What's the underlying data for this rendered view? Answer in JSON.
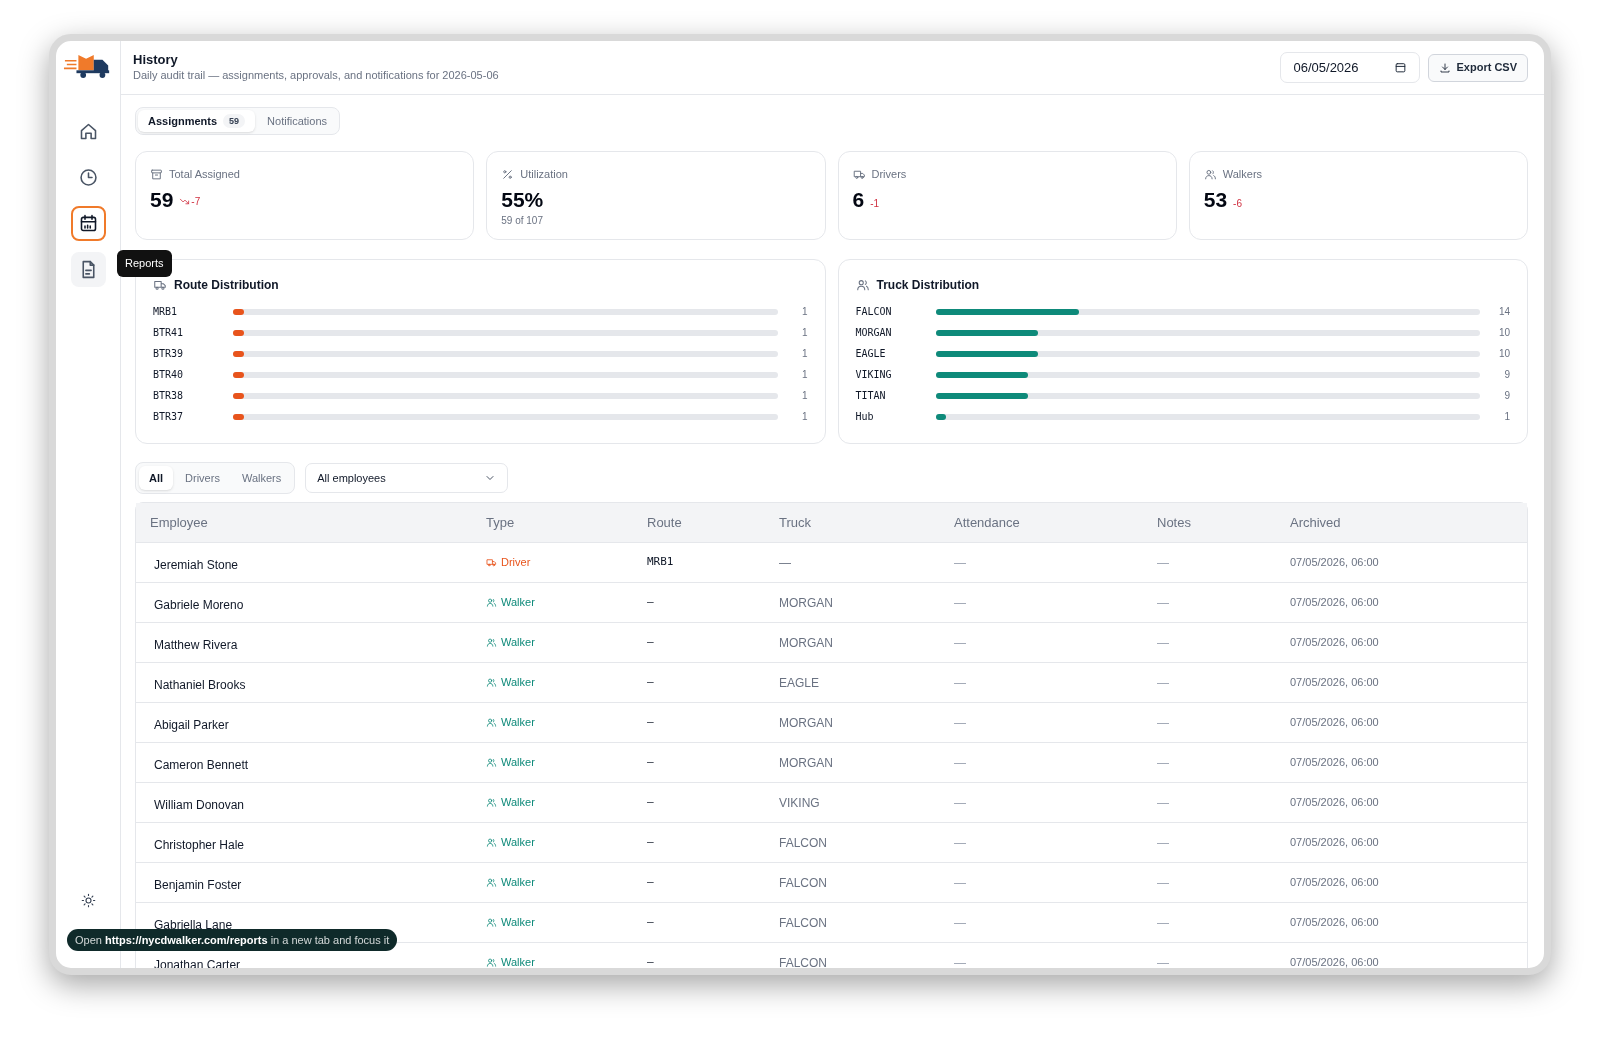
{
  "header": {
    "title": "History",
    "subtitle": "Daily audit trail — assignments, approvals, and notifications for 2026-05-06",
    "date": "06/05/2026",
    "export_label": "Export CSV"
  },
  "sidebar": {
    "items": [
      {
        "kind": "home",
        "selected": false,
        "hovered": false
      },
      {
        "kind": "history",
        "selected": false,
        "hovered": false
      },
      {
        "kind": "calendar",
        "selected": true,
        "hovered": false
      },
      {
        "kind": "reports",
        "selected": false,
        "hovered": true
      }
    ],
    "tooltip": "Reports"
  },
  "tabs": [
    {
      "label": "Assignments",
      "count": "59",
      "selected": true
    },
    {
      "label": "Notifications",
      "selected": false
    }
  ],
  "stats": [
    {
      "kind": "archive",
      "label": "Total Assigned",
      "value": "59",
      "delta": "-7",
      "trend_arrow": true
    },
    {
      "kind": "percent",
      "label": "Utilization",
      "value": "55%",
      "sub": "59 of 107"
    },
    {
      "kind": "truck",
      "label": "Drivers",
      "value": "6",
      "delta": "-1"
    },
    {
      "kind": "people",
      "label": "Walkers",
      "value": "53",
      "delta": "-6"
    }
  ],
  "distributions": [
    {
      "kind": "route",
      "title": "Route Distribution",
      "rows": [
        {
          "label": "MRB1",
          "count": "1",
          "level": 0.02
        },
        {
          "label": "BTR41",
          "count": "1",
          "level": 0.02
        },
        {
          "label": "BTR39",
          "count": "1",
          "level": 0.02
        },
        {
          "label": "BTR40",
          "count": "1",
          "level": 0.02
        },
        {
          "label": "BTR38",
          "count": "1",
          "level": 0.02
        },
        {
          "label": "BTR37",
          "count": "1",
          "level": 0.02
        }
      ]
    },
    {
      "kind": "truck",
      "title": "Truck Distribution",
      "rows": [
        {
          "label": "FALCON",
          "count": "14",
          "level": 0.264
        },
        {
          "label": "MORGAN",
          "count": "10",
          "level": 0.189
        },
        {
          "label": "EAGLE",
          "count": "10",
          "level": 0.189
        },
        {
          "label": "VIKING",
          "count": "9",
          "level": 0.17
        },
        {
          "label": "TITAN",
          "count": "9",
          "level": 0.17
        },
        {
          "label": "Hub",
          "count": "1",
          "level": 0.019
        }
      ]
    }
  ],
  "filters": [
    {
      "label": "All",
      "selected": true
    },
    {
      "label": "Drivers",
      "selected": false
    },
    {
      "label": "Walkers",
      "selected": false
    }
  ],
  "employee_select": "All employees",
  "table": {
    "columns": [
      "Employee",
      "Type",
      "Route",
      "Truck",
      "Attendance",
      "Notes",
      "Archived"
    ],
    "rows": [
      {
        "employee": "Jeremiah Stone",
        "type": {
          "kind": "driver",
          "label": "Driver"
        },
        "route": "MRB1",
        "truck": "—",
        "attendance": "—",
        "notes": "—",
        "archived": "07/05/2026, 06:00"
      },
      {
        "employee": "Gabriele Moreno",
        "type": {
          "kind": "walker",
          "label": "Walker"
        },
        "route": "–",
        "truck": "MORGAN",
        "attendance": "—",
        "notes": "—",
        "archived": "07/05/2026, 06:00"
      },
      {
        "employee": "Matthew Rivera",
        "type": {
          "kind": "walker",
          "label": "Walker"
        },
        "route": "–",
        "truck": "MORGAN",
        "attendance": "—",
        "notes": "—",
        "archived": "07/05/2026, 06:00"
      },
      {
        "employee": "Nathaniel Brooks",
        "type": {
          "kind": "walker",
          "label": "Walker"
        },
        "route": "–",
        "truck": "EAGLE",
        "attendance": "—",
        "notes": "—",
        "archived": "07/05/2026, 06:00"
      },
      {
        "employee": "Abigail Parker",
        "type": {
          "kind": "walker",
          "label": "Walker"
        },
        "route": "–",
        "truck": "MORGAN",
        "attendance": "—",
        "notes": "—",
        "archived": "07/05/2026, 06:00"
      },
      {
        "employee": "Cameron Bennett",
        "type": {
          "kind": "walker",
          "label": "Walker"
        },
        "route": "–",
        "truck": "MORGAN",
        "attendance": "—",
        "notes": "—",
        "archived": "07/05/2026, 06:00"
      },
      {
        "employee": "William Donovan",
        "type": {
          "kind": "walker",
          "label": "Walker"
        },
        "route": "–",
        "truck": "VIKING",
        "attendance": "—",
        "notes": "—",
        "archived": "07/05/2026, 06:00"
      },
      {
        "employee": "Christopher Hale",
        "type": {
          "kind": "walker",
          "label": "Walker"
        },
        "route": "–",
        "truck": "FALCON",
        "attendance": "—",
        "notes": "—",
        "archived": "07/05/2026, 06:00"
      },
      {
        "employee": "Benjamin Foster",
        "type": {
          "kind": "walker",
          "label": "Walker"
        },
        "route": "–",
        "truck": "FALCON",
        "attendance": "—",
        "notes": "—",
        "archived": "07/05/2026, 06:00"
      },
      {
        "employee": "Gabriella Lane",
        "type": {
          "kind": "walker",
          "label": "Walker"
        },
        "route": "–",
        "truck": "FALCON",
        "attendance": "—",
        "notes": "—",
        "archived": "07/05/2026, 06:00"
      },
      {
        "employee": "Jonathan Carter",
        "type": {
          "kind": "walker",
          "label": "Walker"
        },
        "route": "–",
        "truck": "FALCON",
        "attendance": "—",
        "notes": "—",
        "archived": "07/05/2026, 06:00"
      }
    ]
  },
  "link_tooltip": "Open **https://nycdwalker.com/reports** in a new tab and focus it"
}
